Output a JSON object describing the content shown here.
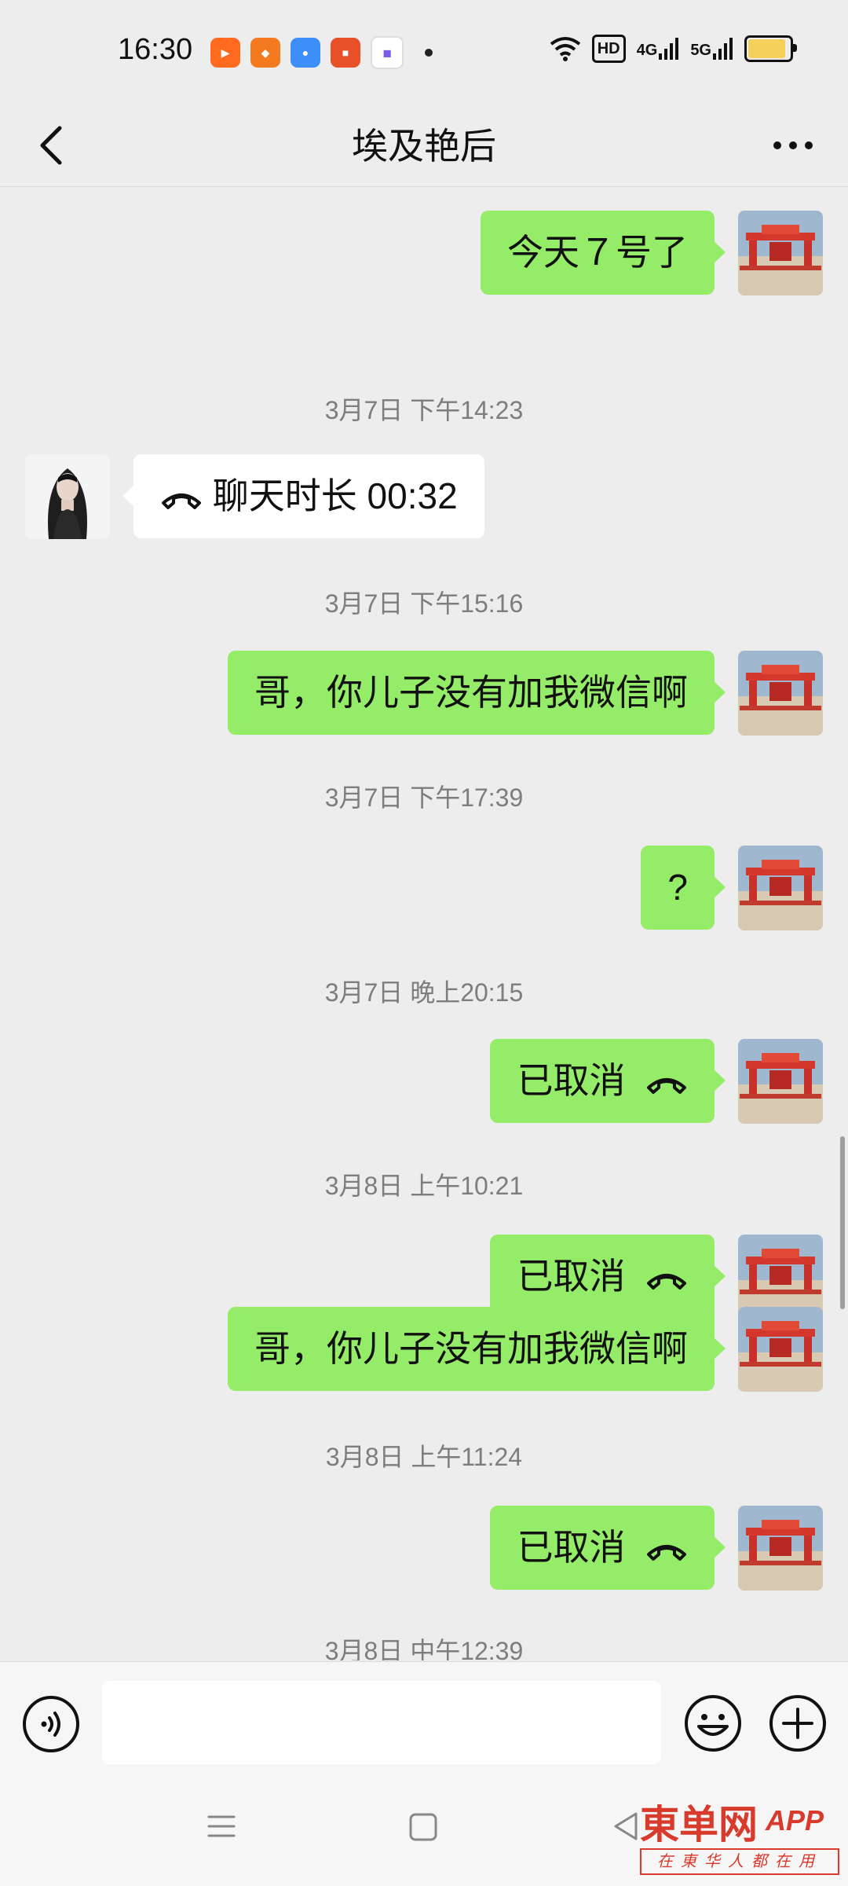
{
  "status_bar": {
    "time": "16:30",
    "apps": [
      {
        "icon": "kuaishou-app-icon",
        "color": "#ff6a1f"
      },
      {
        "icon": "fox-app-icon",
        "color": "#f47a20"
      },
      {
        "icon": "map-app-icon",
        "color": "#3d8ef7"
      },
      {
        "icon": "dingdan-app-icon",
        "color": "#e8502a"
      },
      {
        "icon": "purple-app-icon",
        "color": "#7b5ce6"
      }
    ],
    "hd_label": "HD",
    "net1": "4G",
    "net2": "5G",
    "battery_level": 0.9
  },
  "header": {
    "title": "埃及艳后"
  },
  "messages": [
    {
      "type": "bubble",
      "side": "out",
      "text": "今天７号了",
      "call": false
    },
    {
      "type": "time",
      "text": "3月7日 下午14:23"
    },
    {
      "type": "bubble",
      "side": "in",
      "text": "聊天时长 00:32",
      "call": true
    },
    {
      "type": "time",
      "text": "3月7日 下午15:16"
    },
    {
      "type": "bubble",
      "side": "out",
      "text": "哥，你儿子没有加我微信啊",
      "call": false
    },
    {
      "type": "time",
      "text": "3月7日 下午17:39"
    },
    {
      "type": "bubble",
      "side": "out",
      "text": "?",
      "call": false
    },
    {
      "type": "time",
      "text": "3月7日 晚上20:15"
    },
    {
      "type": "bubble",
      "side": "out",
      "text": "已取消",
      "call": true
    },
    {
      "type": "time",
      "text": "3月8日 上午10:21"
    },
    {
      "type": "bubble",
      "side": "out",
      "text": "已取消",
      "call": true
    },
    {
      "type": "bubble",
      "side": "out",
      "text": "哥，你儿子没有加我微信啊",
      "call": false
    },
    {
      "type": "time",
      "text": "3月8日 上午11:24"
    },
    {
      "type": "bubble",
      "side": "out",
      "text": "已取消",
      "call": true
    },
    {
      "type": "time",
      "text": "3月8日 中午12:39"
    }
  ],
  "input_bar": {
    "value": ""
  },
  "watermark": {
    "logo": "東单网",
    "app": "APP",
    "tagline": "在東华人都在用"
  },
  "colors": {
    "out_bubble": "#95ec69",
    "in_bubble": "#ffffff",
    "background": "#ededed"
  }
}
